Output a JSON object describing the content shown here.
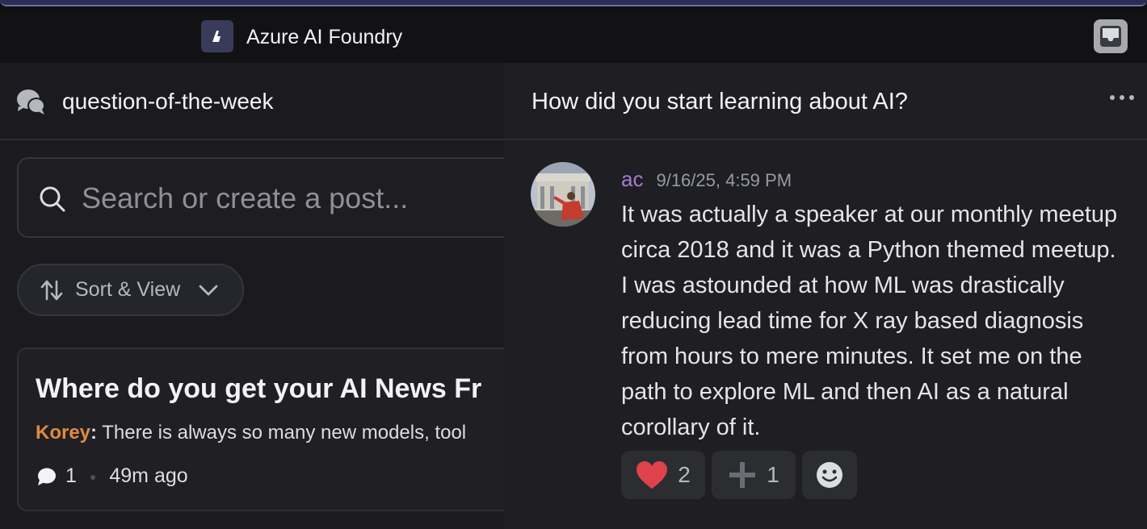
{
  "window": {
    "app_title": "Azure AI Foundry"
  },
  "channel": {
    "name": "question-of-the-week"
  },
  "search": {
    "placeholder": "Search or create a post..."
  },
  "sort": {
    "label": "Sort & View"
  },
  "post": {
    "title": "Where do you get your AI News Fr",
    "author": "Korey",
    "separator": ":",
    "preview": " There is always so many new models, tool",
    "reply_count": "1",
    "age": "49m ago"
  },
  "thread": {
    "title": "How did you start learning about AI?",
    "message": {
      "user": "ac",
      "timestamp": "9/16/25, 4:59 PM",
      "body": "It was actually a speaker at our monthly meetup\ncirca 2018  and it was a Python themed meetup.\nI was astounded at how ML was drastically\nreducing lead time for X ray based diagnosis\nfrom hours to mere minutes. It set me on the\npath to explore ML and then AI as a natural\ncorollary of it."
    },
    "reactions": [
      {
        "icon": "heart-icon",
        "count": "2"
      },
      {
        "icon": "plus-icon",
        "count": "1"
      }
    ]
  },
  "colors": {
    "author": "#e08a3c",
    "username": "#a97ad0",
    "heart": "#e0424b"
  }
}
